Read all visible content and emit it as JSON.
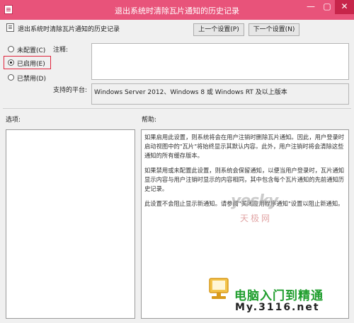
{
  "window": {
    "title": "退出系统时清除瓦片通知的历史记录",
    "min_glyph": "—",
    "max_glyph": "▢",
    "close_glyph": "✕"
  },
  "policy": {
    "name": "退出系统时清除瓦片通知的历史记录"
  },
  "nav": {
    "prev_label": "上一个设置(P)",
    "next_label": "下一个设置(N)"
  },
  "state": {
    "options": [
      {
        "label": "未配置(C)",
        "checked": false
      },
      {
        "label": "已启用(E)",
        "checked": true
      },
      {
        "label": "已禁用(D)",
        "checked": false
      }
    ]
  },
  "comment": {
    "label": "注释:",
    "value": ""
  },
  "platform": {
    "label": "支持的平台:",
    "value": "Windows Server 2012、Windows 8 或 Windows RT 及以上版本"
  },
  "sections": {
    "options_label": "选项:",
    "help_label": "帮助:"
  },
  "help": {
    "paragraphs": [
      "如果启用此设置，则系统将会在用户注销时删除瓦片通知。因此，用户登录时启动视图中的\"瓦片\"将始终显示其默认内容。此外，用户注销时将会清除这些通知的所有缓存版本。",
      "如果禁用或未配置此设置，则系统会保留通知，以便当用户登录时，瓦片通知显示内容与用户注销时显示的内容相同，其中包含每个瓦片通知的先前通知历史记录。",
      "此设置不会阻止显示新通知。请参阅\"关闭应用程序通知\"设置以阻止新通知。"
    ]
  },
  "watermarks": {
    "yesky": "yesky",
    "tianji": "天极网",
    "pcedu": "电脑入门到精通",
    "url": "My.3116.net"
  },
  "colors": {
    "titlebar": "#e8537a",
    "highlight": "#e0243c",
    "pcedu": "#1e9d2c"
  }
}
